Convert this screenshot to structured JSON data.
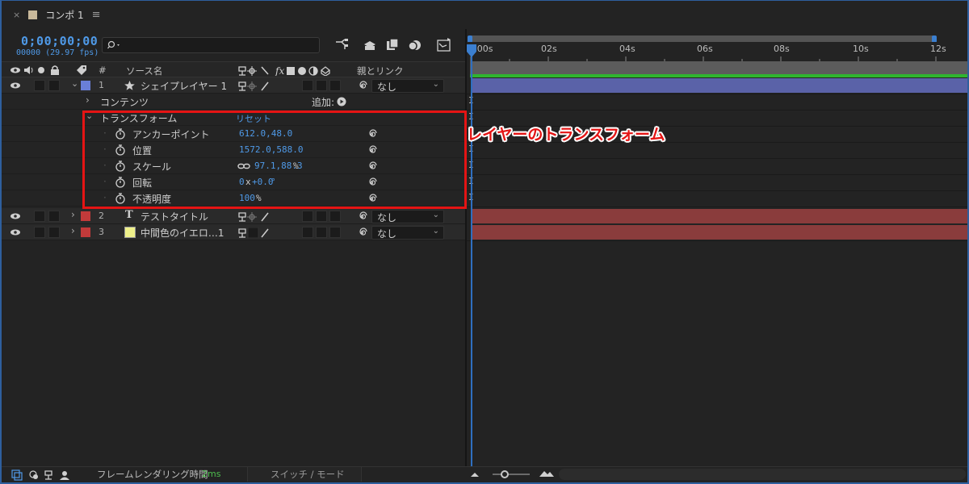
{
  "tab": {
    "close": "×",
    "title": "コンポ 1",
    "menu": "≡"
  },
  "header": {
    "timecode": "0;00;00;00",
    "fps": "00000 (29.97 fps)"
  },
  "columns": {
    "number": "#",
    "source_name": "ソース名",
    "parent_link": "親とリンク"
  },
  "layers": [
    {
      "number": "1",
      "name": "シェイプレイヤー 1",
      "label_color": "#6a7fd8",
      "parent": "なし",
      "track_color": "#5a62a8"
    },
    {
      "number": "2",
      "name": "テストタイトル",
      "label_color": "#c23a3a",
      "parent": "なし",
      "track_color": "#8a3c3c"
    },
    {
      "number": "3",
      "name": "中間色のイエロ…1",
      "label_color": "#c23a3a",
      "parent": "なし",
      "track_color": "#8a3c3c"
    }
  ],
  "contents": {
    "label": "コンテンツ",
    "add": "追加:"
  },
  "transform": {
    "label": "トランスフォーム",
    "reset": "リセット",
    "props": [
      {
        "name": "アンカーポイント",
        "value": "612.0,48.0"
      },
      {
        "name": "位置",
        "value": "1572.0,588.0"
      },
      {
        "name": "スケール",
        "value": "97.1,88.3",
        "unit": "%"
      },
      {
        "name": "回転",
        "value": "0",
        "mid": "x",
        "value2": "+0.0",
        "unit": "°"
      },
      {
        "name": "不透明度",
        "value": "100",
        "unit": "%"
      }
    ]
  },
  "ruler": {
    "labels": [
      "0:00s",
      "02s",
      "04s",
      "06s",
      "08s",
      "10s",
      "12s"
    ]
  },
  "annotation": {
    "text": "レイヤーのトランスフォーム",
    "color": "#e51414"
  },
  "bottom": {
    "render_label": "フレームレンダリング時間",
    "render_value": "2ms",
    "switch_mode": "スイッチ / モード"
  },
  "colors": {
    "accent": "#4f9ae8",
    "playhead": "#2f6fc0",
    "workarea_green": "#2fb52f"
  }
}
